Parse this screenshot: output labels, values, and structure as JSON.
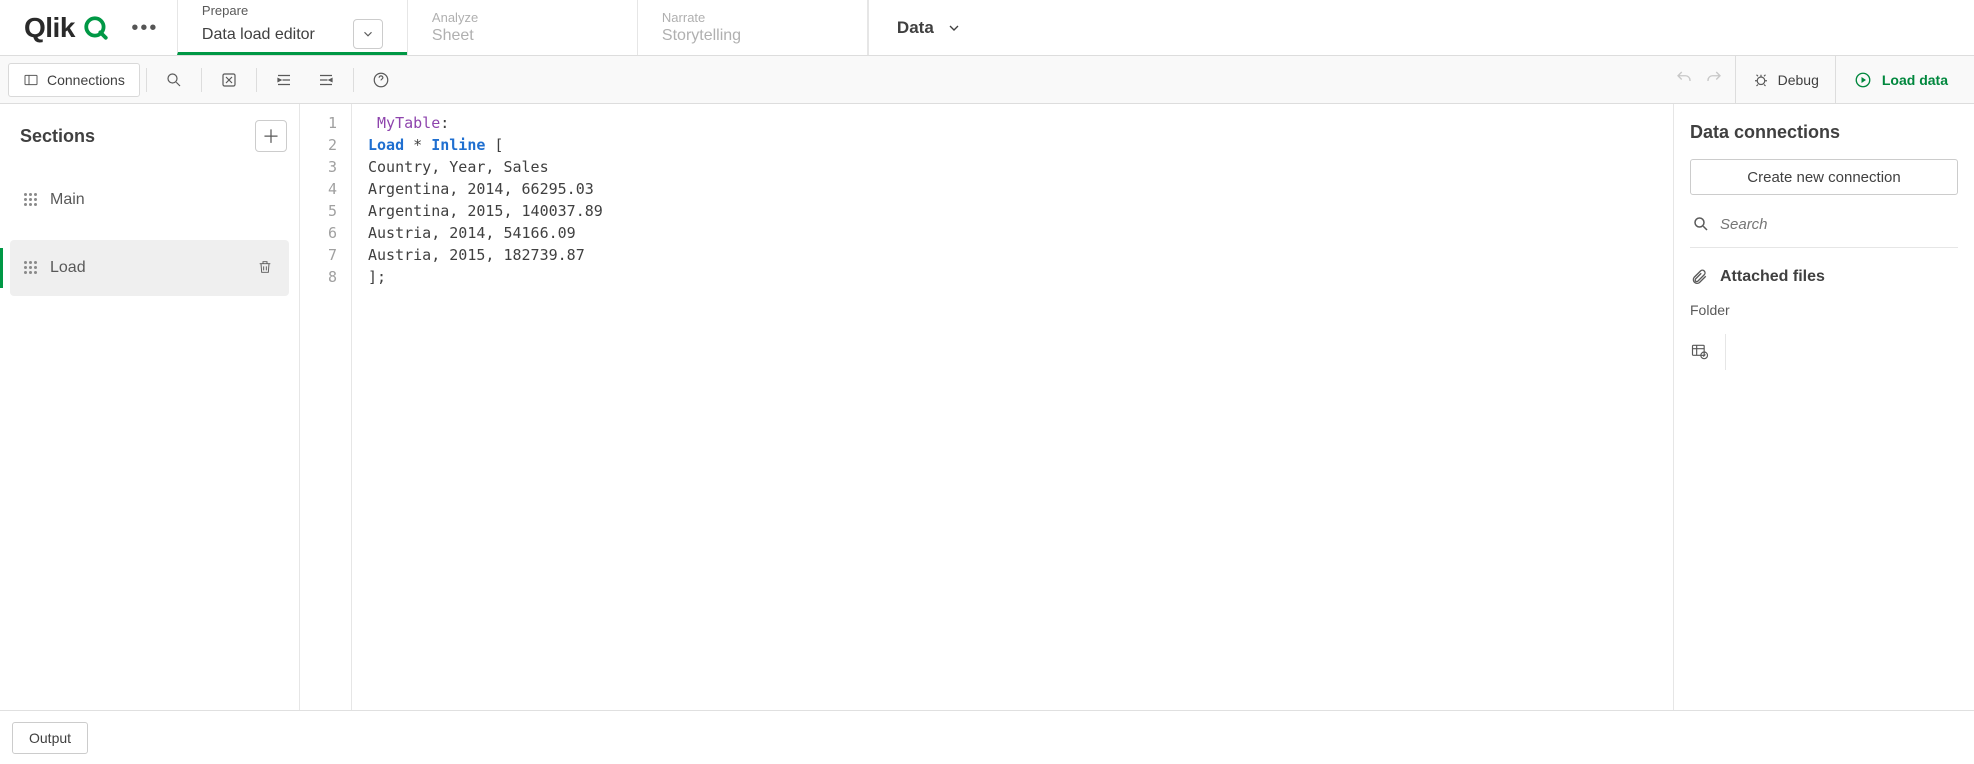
{
  "brand": {
    "name": "Qlik"
  },
  "topnav": {
    "tabs": [
      {
        "small": "Prepare",
        "big": "Data load editor",
        "active": true
      },
      {
        "small": "Analyze",
        "big": "Sheet",
        "active": false
      },
      {
        "small": "Narrate",
        "big": "Storytelling",
        "active": false
      }
    ],
    "dataMenu": "Data"
  },
  "toolbar": {
    "connections": "Connections",
    "debug": "Debug",
    "loadData": "Load data"
  },
  "sidebar": {
    "title": "Sections",
    "items": [
      {
        "name": "Main",
        "active": false
      },
      {
        "name": "Load",
        "active": true
      }
    ]
  },
  "editor": {
    "lineCount": 8,
    "lines": {
      "l1_label": "MyTable",
      "l1_colon": ":",
      "l2_load": "Load",
      "l2_star": " * ",
      "l2_inline": "Inline",
      "l2_bracket": " [",
      "l3": "Country, Year, Sales",
      "l4": "Argentina, 2014, 66295.03",
      "l5": "Argentina, 2015, 140037.89",
      "l6": "Austria, 2014, 54166.09",
      "l7": "Austria, 2015, 182739.87",
      "l8": "];"
    }
  },
  "rightpanel": {
    "title": "Data connections",
    "createBtn": "Create new connection",
    "searchPlaceholder": "Search",
    "attached": "Attached files",
    "folder": "Folder"
  },
  "bottom": {
    "output": "Output"
  }
}
